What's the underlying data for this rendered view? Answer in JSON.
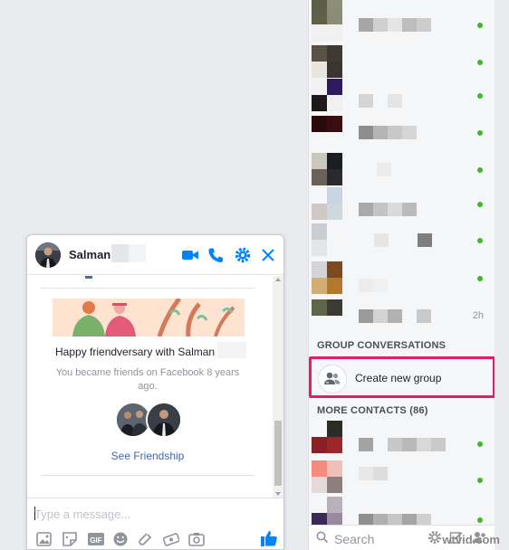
{
  "sidebar": {
    "group_section_title": "GROUP CONVERSATIONS",
    "create_group_label": "Create new group",
    "more_contacts_title": "MORE CONTACTS (86)",
    "recent_time": "2h",
    "search_placeholder": "Search",
    "online_color": "#42b72a",
    "highlight_color": "#e21f63"
  },
  "chat": {
    "name": "Salman",
    "accent_color": "#0084ff",
    "friendversary_title": "Happy friendversary with Salman",
    "friendversary_sub": "You became friends on Facebook 8 years ago.",
    "see_friendship": "See Friendship",
    "input_placeholder": "Type a message...",
    "header_icons": [
      "video-camera-icon",
      "phone-icon",
      "gear-icon",
      "close-icon"
    ],
    "toolbar_icons": [
      "photo-icon",
      "sticker-icon",
      "gif-icon",
      "emoji-icon",
      "attachment-icon",
      "camera-icon",
      "like-icon"
    ]
  },
  "watermark": "wtvid.com"
}
